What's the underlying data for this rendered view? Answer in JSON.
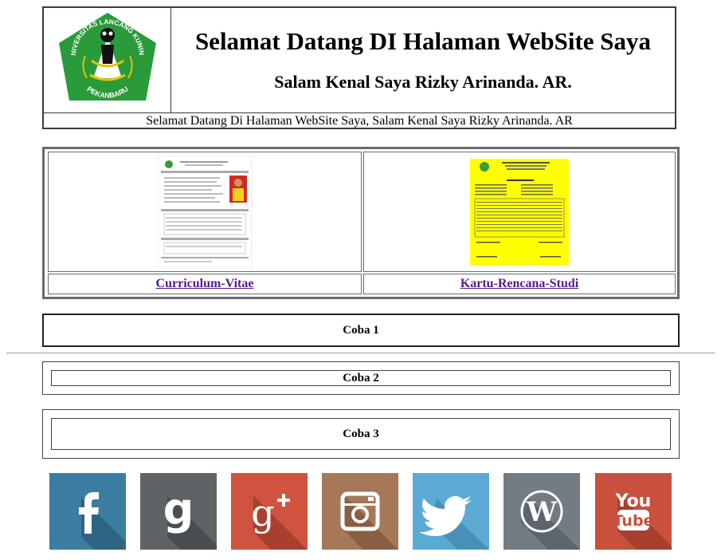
{
  "header": {
    "logo_text_top": "UNIVERSITAS LANCANG KUNING",
    "logo_text_bottom": "PEKANBARU",
    "title": "Selamat Datang DI Halaman WebSite Saya",
    "subtitle": "Salam Kenal Saya Rizky Arinanda. AR.",
    "welcome": "Selamat Datang Di Halaman WebSite Saya, Salam Kenal Saya Rizky Arinanda. AR"
  },
  "documents": [
    {
      "label": "Curriculum-Vitae",
      "thumb": "cv-thumbnail"
    },
    {
      "label": "Kartu-Rencana-Studi",
      "thumb": "krs-thumbnail"
    }
  ],
  "boxes": [
    "Coba 1",
    "Coba 2",
    "Coba 3"
  ],
  "social": [
    {
      "name": "facebook-icon",
      "color": "#3b7ea1"
    },
    {
      "name": "goodreads-icon",
      "color": "#5e6366"
    },
    {
      "name": "google-plus-icon",
      "color": "#d0533f"
    },
    {
      "name": "instagram-icon",
      "color": "#a6785a"
    },
    {
      "name": "twitter-icon",
      "color": "#5aaad4"
    },
    {
      "name": "wordpress-icon",
      "color": "#737b83"
    },
    {
      "name": "youtube-icon",
      "color": "#c8503c"
    }
  ],
  "colors": {
    "link": "#551a8b",
    "logo_green": "#2a9a3a",
    "krs_yellow": "#ffff00"
  }
}
